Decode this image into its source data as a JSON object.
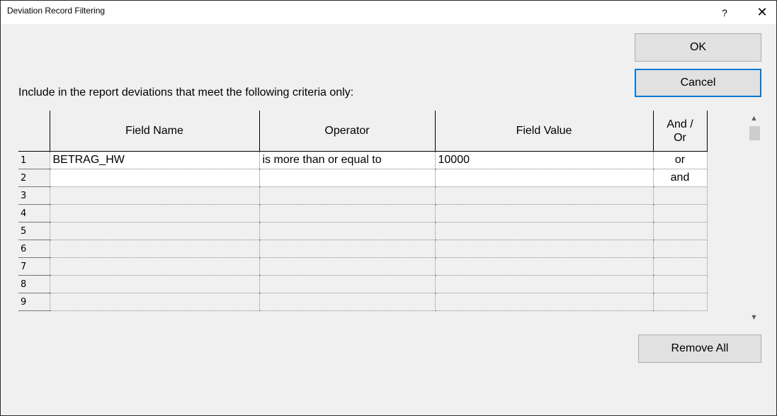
{
  "window": {
    "title": "Deviation Record Filtering",
    "help_label": "?",
    "close_label": "✕"
  },
  "buttons": {
    "ok": "OK",
    "cancel": "Cancel",
    "remove_all": "Remove All"
  },
  "prompt": "Include in the report deviations that meet the following criteria only:",
  "table": {
    "headers": {
      "field_name": "Field Name",
      "operator": "Operator",
      "field_value": "Field Value",
      "and_or": "And / Or"
    },
    "rows": [
      {
        "num": "1",
        "field_name": "BETRAG_HW",
        "operator": "is more than or equal to",
        "field_value": "10000",
        "and_or": "or"
      },
      {
        "num": "2",
        "field_name": "",
        "operator": "",
        "field_value": "",
        "and_or": "and"
      },
      {
        "num": "3",
        "field_name": "",
        "operator": "",
        "field_value": "",
        "and_or": ""
      },
      {
        "num": "4",
        "field_name": "",
        "operator": "",
        "field_value": "",
        "and_or": ""
      },
      {
        "num": "5",
        "field_name": "",
        "operator": "",
        "field_value": "",
        "and_or": ""
      },
      {
        "num": "6",
        "field_name": "",
        "operator": "",
        "field_value": "",
        "and_or": ""
      },
      {
        "num": "7",
        "field_name": "",
        "operator": "",
        "field_value": "",
        "and_or": ""
      },
      {
        "num": "8",
        "field_name": "",
        "operator": "",
        "field_value": "",
        "and_or": ""
      },
      {
        "num": "9",
        "field_name": "",
        "operator": "",
        "field_value": "",
        "and_or": ""
      }
    ]
  },
  "scrollbar": {
    "up_icon": "chevron-up-icon",
    "down_icon": "chevron-down-icon"
  }
}
